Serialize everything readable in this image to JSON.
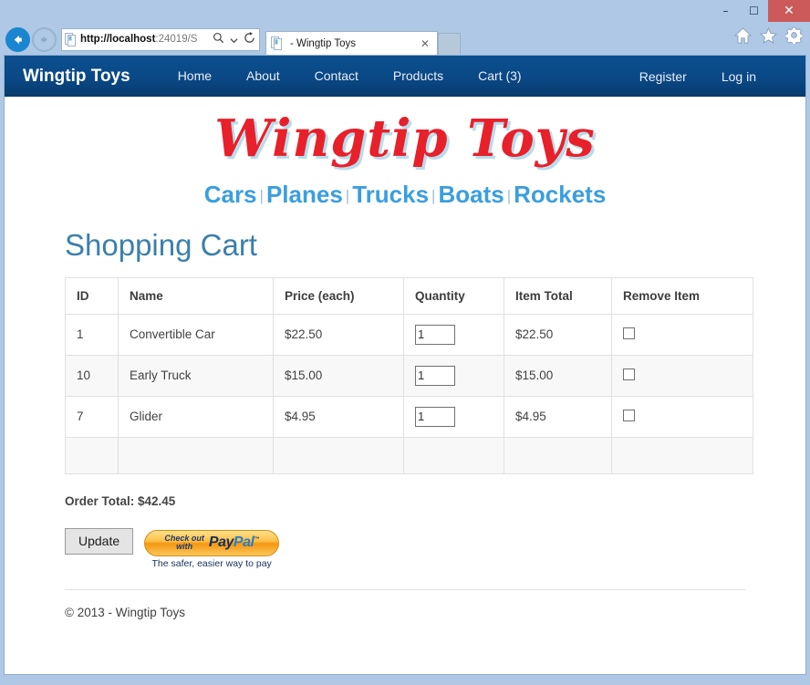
{
  "browser": {
    "back_icon": "back-arrow-icon",
    "forward_icon": "forward-arrow-icon",
    "url_host": "http://localhost",
    "url_rest": ":24019/S",
    "search_icon": "search-icon",
    "dropdown_icon": "chevron-down-icon",
    "refresh_icon": "refresh-icon",
    "tab_title": "- Wingtip Toys",
    "tab_close_icon": "close-icon",
    "new_tab_label": "",
    "tools": [
      {
        "name": "home-icon",
        "glyph": "⌂"
      },
      {
        "name": "favorites-star-icon",
        "glyph": "★"
      },
      {
        "name": "settings-gear-icon",
        "glyph": "⚙"
      }
    ],
    "window_controls": {
      "minimize": "–",
      "maximize": "☐",
      "close": "✕"
    }
  },
  "site": {
    "brand": "Wingtip Toys",
    "nav_left": [
      {
        "label": "Home",
        "name": "nav-link-home"
      },
      {
        "label": "About",
        "name": "nav-link-about"
      },
      {
        "label": "Contact",
        "name": "nav-link-contact"
      },
      {
        "label": "Products",
        "name": "nav-link-products"
      },
      {
        "label": "Cart (3)",
        "name": "nav-link-cart"
      }
    ],
    "nav_right": [
      {
        "label": "Register",
        "name": "nav-link-register"
      },
      {
        "label": "Log in",
        "name": "nav-link-login"
      }
    ],
    "logo_text": "Wingtip Toys",
    "categories": [
      "Cars",
      "Planes",
      "Trucks",
      "Boats",
      "Rockets"
    ],
    "category_separator": "|"
  },
  "main": {
    "page_title": "Shopping Cart",
    "table": {
      "headers": [
        "ID",
        "Name",
        "Price (each)",
        "Quantity",
        "Item Total",
        "Remove Item"
      ],
      "rows": [
        {
          "id": "1",
          "name": "Convertible Car",
          "price": "$22.50",
          "quantity": "1",
          "item_total": "$22.50",
          "remove_checked": false
        },
        {
          "id": "10",
          "name": "Early Truck",
          "price": "$15.00",
          "quantity": "1",
          "item_total": "$15.00",
          "remove_checked": false
        },
        {
          "id": "7",
          "name": "Glider",
          "price": "$4.95",
          "quantity": "1",
          "item_total": "$4.95",
          "remove_checked": false
        }
      ],
      "has_empty_row": true
    },
    "order_total": "Order Total: $42.45",
    "update_button": "Update",
    "paypal": {
      "checkout_line1": "Check out",
      "checkout_line2": "with",
      "logo_pay": "Pay",
      "logo_pal": "Pal",
      "trademark": "™",
      "tagline": "The safer, easier way to pay"
    }
  },
  "footer": {
    "copyright": "© 2013 - Wingtip Toys"
  },
  "colors": {
    "navbar_top": "#0c4f8f",
    "navbar_bottom": "#073b6d",
    "logo_red": "#e8202a",
    "logo_shadow": "#b8dced",
    "category_blue": "#3a9ee0",
    "title_blue": "#3b7fac",
    "chrome_bg": "#aec8e6",
    "close_red": "#cc5a5a",
    "back_blue": "#1a86d0",
    "paypal_orange": "#f6960f"
  }
}
